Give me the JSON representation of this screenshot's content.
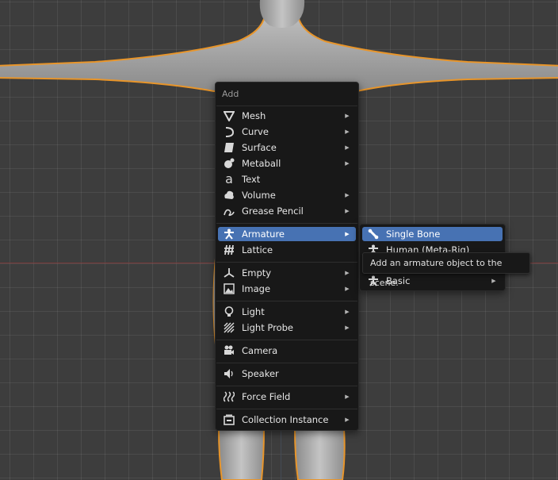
{
  "add_menu": {
    "title": "Add",
    "items": [
      {
        "label": "Mesh",
        "icon": "mesh-icon",
        "submenu": true
      },
      {
        "label": "Curve",
        "icon": "curve-icon",
        "submenu": true
      },
      {
        "label": "Surface",
        "icon": "surface-icon",
        "submenu": true
      },
      {
        "label": "Metaball",
        "icon": "metaball-icon",
        "submenu": true
      },
      {
        "label": "Text",
        "icon": "text-icon",
        "submenu": false
      },
      {
        "label": "Volume",
        "icon": "volume-icon",
        "submenu": true
      },
      {
        "label": "Grease Pencil",
        "icon": "grease-pencil-icon",
        "submenu": true
      },
      {
        "label": "Armature",
        "icon": "armature-icon",
        "submenu": true,
        "active": true
      },
      {
        "label": "Lattice",
        "icon": "lattice-icon",
        "submenu": false
      },
      {
        "label": "Empty",
        "icon": "empty-icon",
        "submenu": true
      },
      {
        "label": "Image",
        "icon": "image-icon",
        "submenu": true
      },
      {
        "label": "Light",
        "icon": "light-icon",
        "submenu": true
      },
      {
        "label": "Light Probe",
        "icon": "light-probe-icon",
        "submenu": true
      },
      {
        "label": "Camera",
        "icon": "camera-icon",
        "submenu": false
      },
      {
        "label": "Speaker",
        "icon": "speaker-icon",
        "submenu": false
      },
      {
        "label": "Force Field",
        "icon": "force-field-icon",
        "submenu": true
      },
      {
        "label": "Collection Instance",
        "icon": "collection-icon",
        "submenu": true
      }
    ]
  },
  "armature_submenu": {
    "items": [
      {
        "label": "Single Bone",
        "icon": "bone-icon",
        "submenu": false,
        "active": true
      },
      {
        "label": "Human (Meta-Rig)",
        "icon": "armature-icon",
        "submenu": false
      },
      {
        "label": "Basic",
        "icon": "armature-icon",
        "submenu": true
      }
    ]
  },
  "tooltip": {
    "text": "Add an armature object to the scene."
  },
  "colors": {
    "accent": "#4772b3",
    "menu_bg": "#181818",
    "selection_outline": "#e8952a"
  }
}
